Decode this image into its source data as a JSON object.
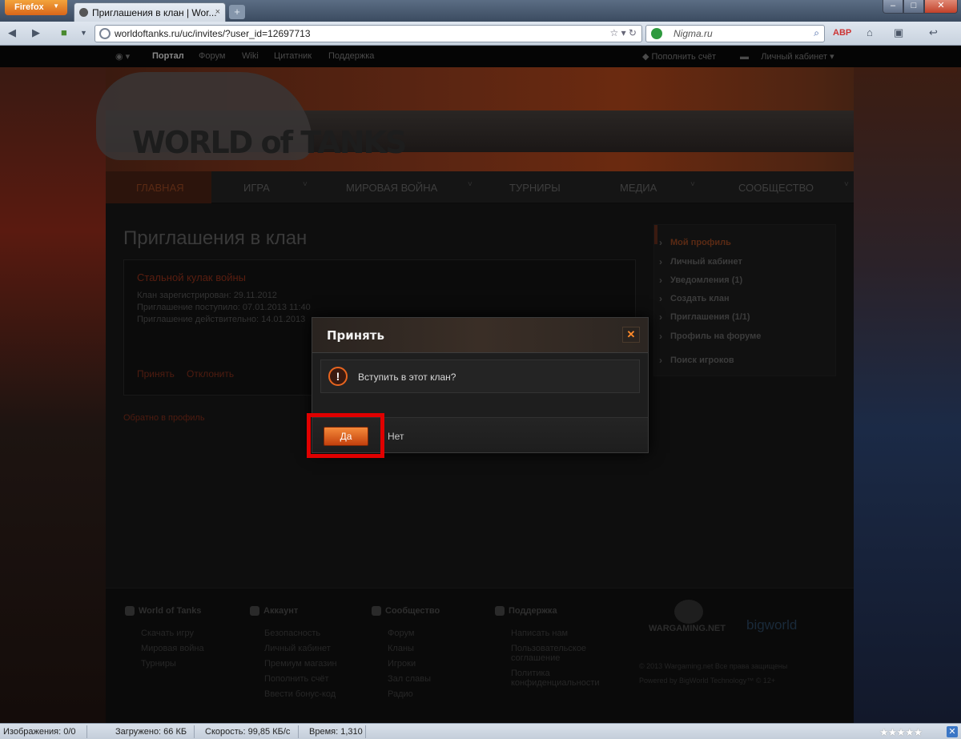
{
  "browser": {
    "menu_button": "Firefox",
    "tab_title": "Приглашения в клан | Wor...",
    "tab_close": "×",
    "new_tab": "+",
    "url": "worldoftanks.ru/uc/invites/?user_id=12697713",
    "search_placeholder": "Nigma.ru",
    "window_min": "–",
    "window_max": "□",
    "window_close": "✕"
  },
  "site_top": {
    "links": [
      "Портал",
      "Форум",
      "Wiki",
      "Цитатник",
      "Поддержка"
    ],
    "pay": "Пополнить счёт",
    "cabinet": "Личный кабинет"
  },
  "logo": "WORLD of TANKS",
  "main_nav": [
    "ГЛАВНАЯ",
    "ИГРА",
    "МИРОВАЯ ВОЙНА",
    "ТУРНИРЫ",
    "МЕДИА",
    "СООБЩЕСТВО"
  ],
  "page": {
    "title": "Приглашения в клан",
    "clan_name": "Стальной кулак войны",
    "registered": "Клан зарегистрирован: 29.11.2012",
    "received": "Приглашение поступило: 07.01.2013 11:40",
    "valid_until": "Приглашение действительно: 14.01.2013",
    "accept": "Принять",
    "reject": "Отклонить",
    "back": "Обратно в профиль"
  },
  "side_menu": [
    "Мой профиль",
    "Личный кабинет",
    "Уведомления (1)",
    "Создать клан",
    "Приглашения (1/1)",
    "Профиль на форуме",
    "Поиск игроков"
  ],
  "footer": {
    "cols": [
      {
        "title": "World of Tanks",
        "links": [
          "Скачать игру",
          "Мировая война",
          "Турниры"
        ]
      },
      {
        "title": "Аккаунт",
        "links": [
          "Безопасность",
          "Личный кабинет",
          "Премиум магазин",
          "Пополнить счёт",
          "Ввести бонус-код"
        ]
      },
      {
        "title": "Сообщество",
        "links": [
          "Форум",
          "Кланы",
          "Игроки",
          "Зал славы",
          "Радио"
        ]
      },
      {
        "title": "Поддержка",
        "links": [
          "Написать нам",
          "Пользовательское",
          "соглашение",
          "Политика",
          "конфиденциальности"
        ]
      }
    ],
    "wargaming": "WARGAMING.NET",
    "bigworld": "bigworld",
    "copyright": "© 2013 Wargaming.net Все права защищены",
    "powered": "Powered by BigWorld Technology™ © 12+"
  },
  "modal": {
    "title": "Принять",
    "close": "✕",
    "icon": "!",
    "question": "Вступить в этот клан?",
    "yes": "Да",
    "no": "Нет"
  },
  "status_bar": {
    "images": "Изображения: 0/0",
    "loaded": "Загружено: 66 КБ",
    "speed": "Скорость: 99,85 КБ/с",
    "time": "Время: 1,310",
    "stars": "★★★★★",
    "addon": "✕"
  },
  "colors": {
    "accent_orange": "#e8651f",
    "highlight_red": "#e00000"
  }
}
